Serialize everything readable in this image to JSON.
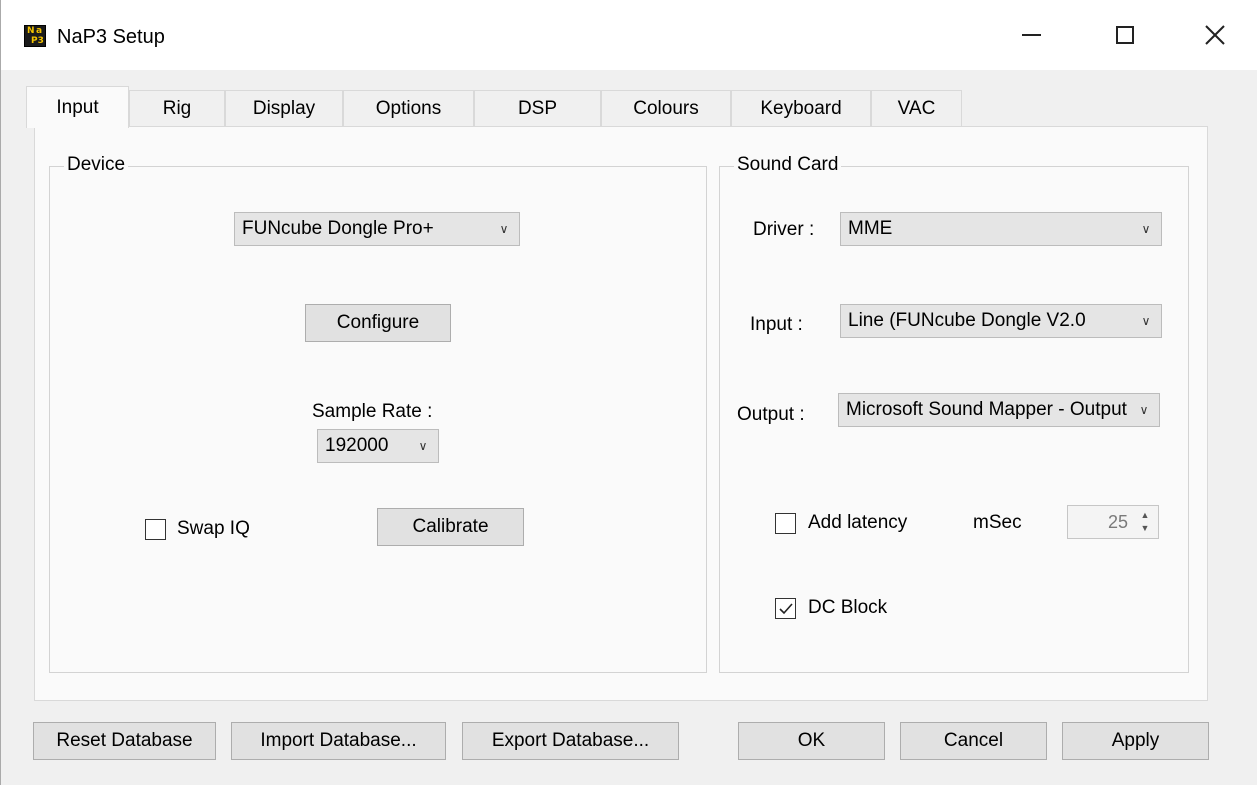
{
  "window": {
    "title": "NaP3 Setup",
    "icon_name": "nap3-app-icon"
  },
  "tabs": [
    {
      "label": "Input"
    },
    {
      "label": "Rig"
    },
    {
      "label": "Display"
    },
    {
      "label": "Options"
    },
    {
      "label": "DSP"
    },
    {
      "label": "Colours"
    },
    {
      "label": "Keyboard"
    },
    {
      "label": "VAC"
    }
  ],
  "device": {
    "group_label": "Device",
    "device_select": "FUNcube Dongle Pro+",
    "configure_label": "Configure",
    "sample_rate_label": "Sample Rate :",
    "sample_rate_value": "192000",
    "swap_iq_label": "Swap IQ",
    "swap_iq_checked": false,
    "calibrate_label": "Calibrate"
  },
  "sound_card": {
    "group_label": "Sound Card",
    "driver_label": "Driver :",
    "driver_value": "MME",
    "input_label": "Input :",
    "input_value": "Line (FUNcube Dongle V2.0",
    "output_label": "Output :",
    "output_value": "Microsoft Sound Mapper - Output",
    "add_latency_label": "Add latency",
    "add_latency_checked": false,
    "msec_label": "mSec",
    "msec_value": "25",
    "dc_block_label": "DC Block",
    "dc_block_checked": true
  },
  "footer": {
    "reset_db": "Reset Database",
    "import_db": "Import Database...",
    "export_db": "Export Database...",
    "ok": "OK",
    "cancel": "Cancel",
    "apply": "Apply"
  }
}
